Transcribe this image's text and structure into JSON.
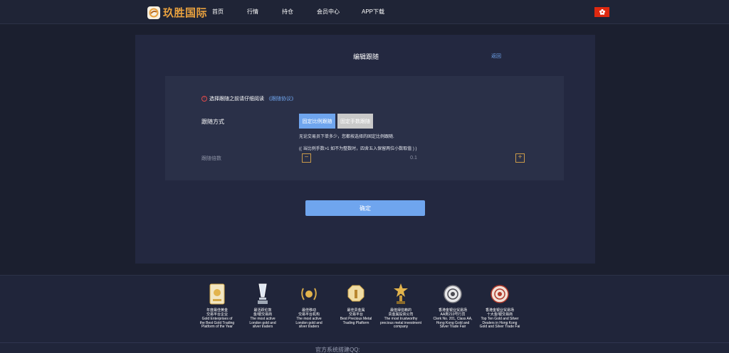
{
  "header": {
    "logo_text": "玖胜国际",
    "nav": [
      "首页",
      "行情",
      "持仓",
      "会员中心",
      "APP下载"
    ],
    "flag_icon": "hong-kong-flag-icon"
  },
  "panel": {
    "title": "编辑跟随",
    "back": "返回",
    "notice_text": "选择跟随之前请仔细阅读",
    "notice_link": "《跟随协议》",
    "method_label": "跟随方式",
    "tab_ratio": "固定比例跟随",
    "tab_lots": "固定手数跟随",
    "hint1": "无论交易员下单多少，您都按选择的固定比例跟随.",
    "hint2": "(( 当比例手数>1 如不为整数时，四舍五入保留两位小数取值 ) )",
    "multiplier_label": "跟随倍数",
    "multiplier_value": "0.1",
    "minus": "−",
    "plus": "+",
    "confirm": "确定"
  },
  "footer": {
    "awards": [
      {
        "title": "年度最佳黄金\n交易平台企业",
        "desc": "Gold Enterprises of\nthe Best Gold Trading\nPlatform of the Year"
      },
      {
        "title": "最活跃伦敦\n金/银交易商",
        "desc": "The most active\nLondon gold and\nsilver traders"
      },
      {
        "title": "最佳移动\n交易平台机构",
        "desc": "The most active\nLondon gold and\nsilver traders"
      },
      {
        "title": "最佳贵金属\n交易平台",
        "desc": "Best Precious Metal\nTrading Platform"
      },
      {
        "title": "最值得信赖的\n贵金属投资公司",
        "desc": "The most trustworthy\nprecious metal investment\ncompany"
      },
      {
        "title": "香港金银业贸易场\nAA类210号行员",
        "desc": "Clerk No. 201, Class AA,\nHong Kong Gold and\nSilver Trade Fair"
      },
      {
        "title": "香港金银业贸易场\n十大金/银交易商",
        "desc": "Top Ten Gold and Silver\nDealers in Hong Kong\nGold and Silver Trade Fai"
      }
    ],
    "bottom_text": "官方系统搭建QQ:"
  }
}
